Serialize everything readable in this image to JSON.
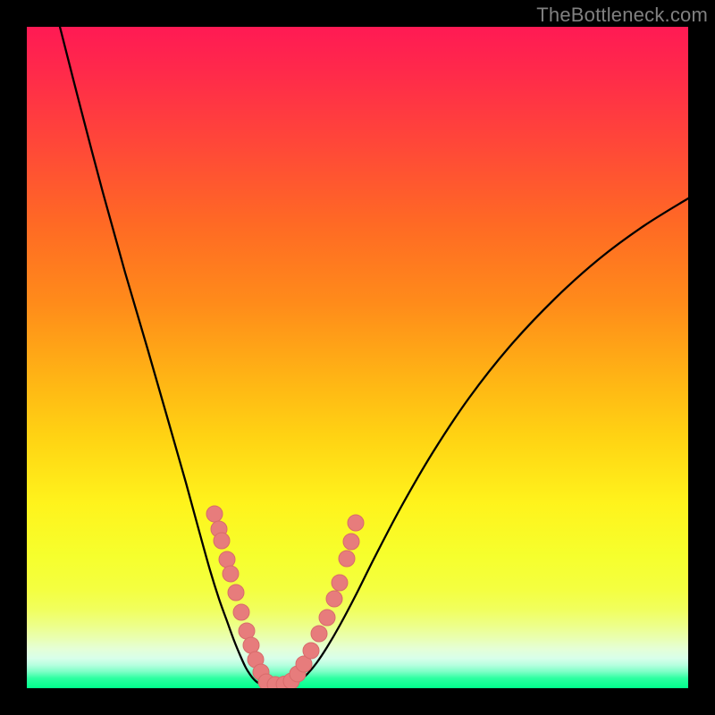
{
  "watermark": "TheBottleneck.com",
  "colors": {
    "page_bg": "#000000",
    "gradient_top": "#ff1a54",
    "gradient_bottom": "#00ff8c",
    "curve": "#000000",
    "marker_fill": "#e77c7c",
    "marker_stroke": "#d86b6b"
  },
  "chart_data": {
    "type": "line",
    "title": "",
    "xlabel": "",
    "ylabel": "",
    "xlim": [
      0,
      740
    ],
    "ylim_top_is_high": true,
    "note": "Axes are unlabeled in source image; numeric axis values are not visible. Curve and marker coordinates are in plot-area pixel space (origin top-left, 740x740).",
    "series": [
      {
        "name": "left-branch",
        "role": "curve",
        "points": [
          [
            37,
            0
          ],
          [
            60,
            90
          ],
          [
            85,
            185
          ],
          [
            110,
            275
          ],
          [
            135,
            360
          ],
          [
            158,
            440
          ],
          [
            178,
            510
          ],
          [
            193,
            565
          ],
          [
            205,
            608
          ],
          [
            215,
            640
          ],
          [
            224,
            665
          ],
          [
            232,
            687
          ],
          [
            239,
            704
          ],
          [
            245,
            717
          ],
          [
            250,
            725
          ],
          [
            254,
            730
          ],
          [
            258,
            733.5
          ],
          [
            262,
            735.2
          ],
          [
            266,
            735.8
          ]
        ]
      },
      {
        "name": "valley-floor",
        "role": "curve",
        "points": [
          [
            266,
            735.8
          ],
          [
            275,
            736
          ],
          [
            284,
            736
          ],
          [
            293,
            735.8
          ]
        ]
      },
      {
        "name": "right-branch",
        "role": "curve",
        "points": [
          [
            293,
            735.8
          ],
          [
            299,
            734.5
          ],
          [
            306,
            731
          ],
          [
            314,
            724
          ],
          [
            324,
            712
          ],
          [
            336,
            694
          ],
          [
            350,
            670
          ],
          [
            368,
            636
          ],
          [
            390,
            592
          ],
          [
            420,
            535
          ],
          [
            455,
            475
          ],
          [
            495,
            415
          ],
          [
            540,
            358
          ],
          [
            590,
            305
          ],
          [
            640,
            260
          ],
          [
            690,
            223
          ],
          [
            740,
            192
          ]
        ]
      }
    ],
    "markers": {
      "name": "dots",
      "radius": 9,
      "points": [
        [
          210,
          545
        ],
        [
          215,
          562
        ],
        [
          218,
          575
        ],
        [
          224,
          596
        ],
        [
          228,
          612
        ],
        [
          234,
          633
        ],
        [
          240,
          655
        ],
        [
          246,
          676
        ],
        [
          251,
          692
        ],
        [
          256,
          708
        ],
        [
          262,
          722
        ],
        [
          268,
          733
        ],
        [
          278,
          736
        ],
        [
          288,
          735.5
        ],
        [
          296,
          732
        ],
        [
          303,
          724
        ],
        [
          310,
          713
        ],
        [
          318,
          698
        ],
        [
          327,
          679
        ],
        [
          336,
          661
        ],
        [
          344,
          640
        ],
        [
          350,
          622
        ],
        [
          358,
          595
        ],
        [
          363,
          576
        ],
        [
          368,
          555
        ]
      ]
    }
  }
}
